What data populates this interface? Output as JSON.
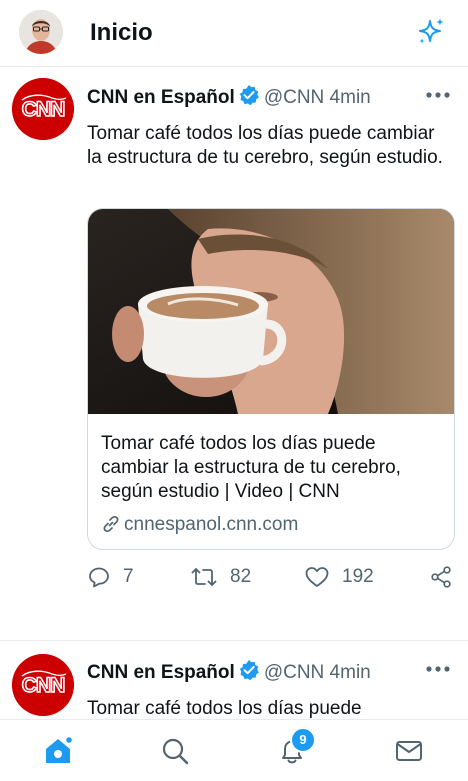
{
  "header": {
    "title": "Inicio",
    "user_avatar_icon": "user-avatar",
    "sparkle_icon": "sparkle-icon"
  },
  "tweets": [
    {
      "author_name": "CNN en Español",
      "handle": "@CNN",
      "time": "4min",
      "text": "Tomar café todos los días puede cambiar la estructura de tu cerebro, según estudio.",
      "card": {
        "title": "Tomar café todos los días puede cambiar la estructura de tu cerebro, según estudio | Video | CNN",
        "domain": "cnnespanol.cnn.com"
      },
      "replies": "7",
      "retweets": "82",
      "likes": "192"
    },
    {
      "author_name": "CNN en Español",
      "handle": "@CNN",
      "time": "4min",
      "text": "Tomar café todos los días puede"
    }
  ],
  "bottom_nav": {
    "notifications_badge": "9"
  },
  "colors": {
    "accent": "#1d9bf0",
    "brand_cnn": "#cc0000",
    "muted": "#536471"
  }
}
